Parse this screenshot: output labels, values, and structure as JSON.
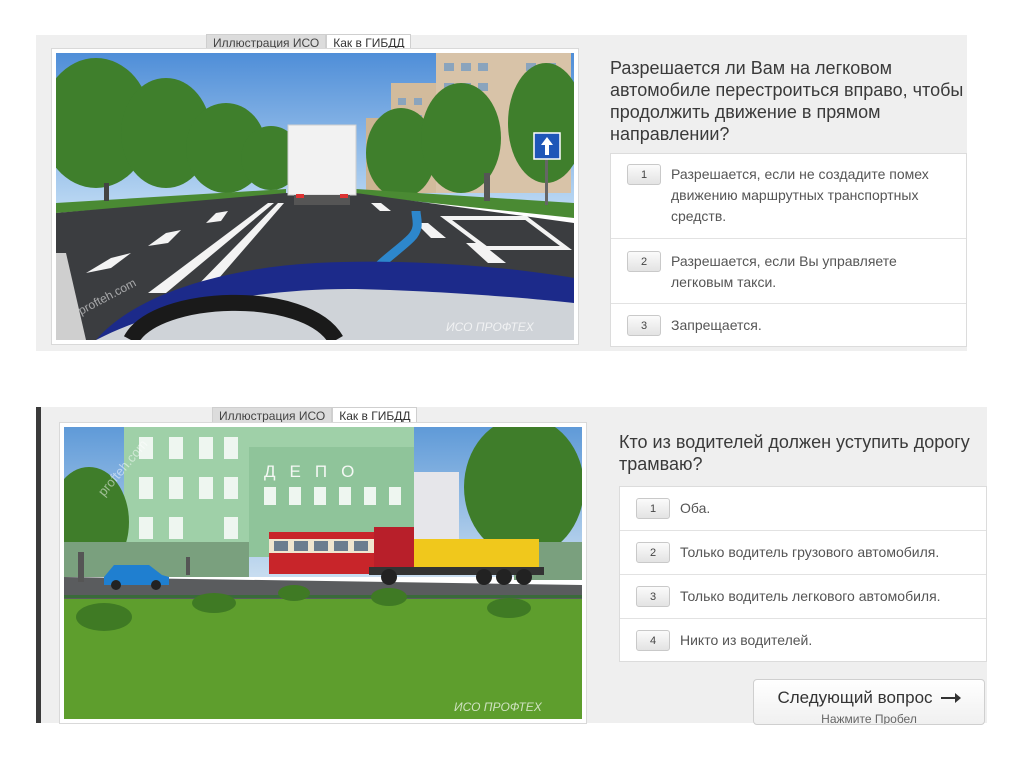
{
  "question1": {
    "tabs": [
      "Иллюстрация ИСО",
      "Как в ГИБДД"
    ],
    "watermarks": [
      "profteh.com",
      "ИСО ПРОФТЕХ"
    ],
    "text": "Разрешается ли Вам на легковом автомобиле перестроиться вправо, чтобы продолжить движение в прямом направлении?",
    "answers": [
      {
        "num": "1",
        "text": "Разрешается, если не создадите помех движению маршрутных транспортных средств."
      },
      {
        "num": "2",
        "text": "Разрешается, если Вы управляете легковым такси."
      },
      {
        "num": "3",
        "text": "Запрещается."
      }
    ]
  },
  "question2": {
    "tabs": [
      "Иллюстрация ИСО",
      "Как в ГИБДД"
    ],
    "watermarks": [
      "profteh.com",
      "ИСО ПРОФТЕХ"
    ],
    "depot_sign": "ДЕПО",
    "text": "Кто из водителей должен уступить дорогу трамваю?",
    "answers": [
      {
        "num": "1",
        "text": "Оба."
      },
      {
        "num": "2",
        "text": "Только водитель грузового автомобиля."
      },
      {
        "num": "3",
        "text": "Только водитель легкового автомобиля."
      },
      {
        "num": "4",
        "text": "Никто из водителей."
      }
    ]
  },
  "next_button": {
    "title": "Следующий вопрос",
    "subtitle": "Нажмите Пробел",
    "icon": "arrow-right-icon"
  }
}
